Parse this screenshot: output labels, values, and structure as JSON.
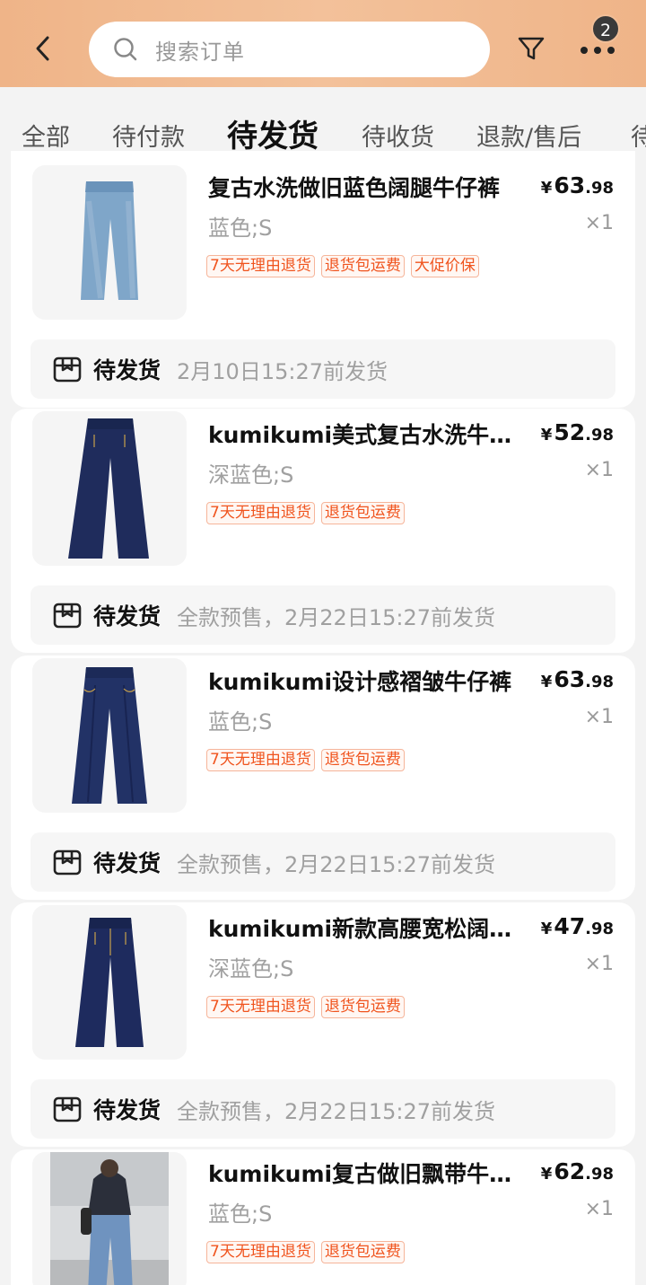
{
  "header": {
    "search_placeholder": "搜索订单",
    "badge_count": "2"
  },
  "tabs": [
    {
      "label": "全部"
    },
    {
      "label": "待付款"
    },
    {
      "label": "待发货",
      "active": true
    },
    {
      "label": "待收货"
    },
    {
      "label": "退款/售后"
    },
    {
      "label": "待"
    }
  ],
  "orders": [
    {
      "title": "复古水洗做旧蓝色阔腿牛仔裤",
      "price_symbol": "¥",
      "price_int": "63",
      "price_dec": ".98",
      "spec": "蓝色;S",
      "qty": "×1",
      "tags": [
        "7天无理由退货",
        "退货包运费",
        "大促价保"
      ],
      "status_label": "待发货",
      "status_text": "2月10日15:27前发货",
      "image": "light-blue-wide-leg-jeans"
    },
    {
      "title": "kumikumi美式复古水洗牛仔裤",
      "price_symbol": "¥",
      "price_int": "52",
      "price_dec": ".98",
      "spec": "深蓝色;S",
      "qty": "×1",
      "tags": [
        "7天无理由退货",
        "退货包运费"
      ],
      "status_label": "待发货",
      "status_text": "全款预售，2月22日15:27前发货",
      "image": "dark-blue-wide-leg-jeans"
    },
    {
      "title": "kumikumi设计感褶皱牛仔裤",
      "price_symbol": "¥",
      "price_int": "63",
      "price_dec": ".98",
      "spec": "蓝色;S",
      "qty": "×1",
      "tags": [
        "7天无理由退货",
        "退货包运费"
      ],
      "status_label": "待发货",
      "status_text": "全款预售，2月22日15:27前发货",
      "image": "pleated-dark-jeans"
    },
    {
      "title": "kumikumi新款高腰宽松阔腿牛仔裤",
      "price_symbol": "¥",
      "price_int": "47",
      "price_dec": ".98",
      "spec": "深蓝色;S",
      "qty": "×1",
      "tags": [
        "7天无理由退货",
        "退货包运费"
      ],
      "status_label": "待发货",
      "status_text": "全款预售，2月22日15:27前发货",
      "image": "high-waist-dark-jeans"
    },
    {
      "title": "kumikumi复古做旧飘带牛仔裤",
      "price_symbol": "¥",
      "price_int": "62",
      "price_dec": ".98",
      "spec": "蓝色;S",
      "qty": "×1",
      "tags": [
        "7天无理由退货",
        "退货包运费"
      ],
      "image": "model-street-photo"
    }
  ],
  "colors": {
    "header_gradient": "#f0b78c",
    "tag_text": "#f0541e",
    "tag_border": "#f6b59a"
  }
}
